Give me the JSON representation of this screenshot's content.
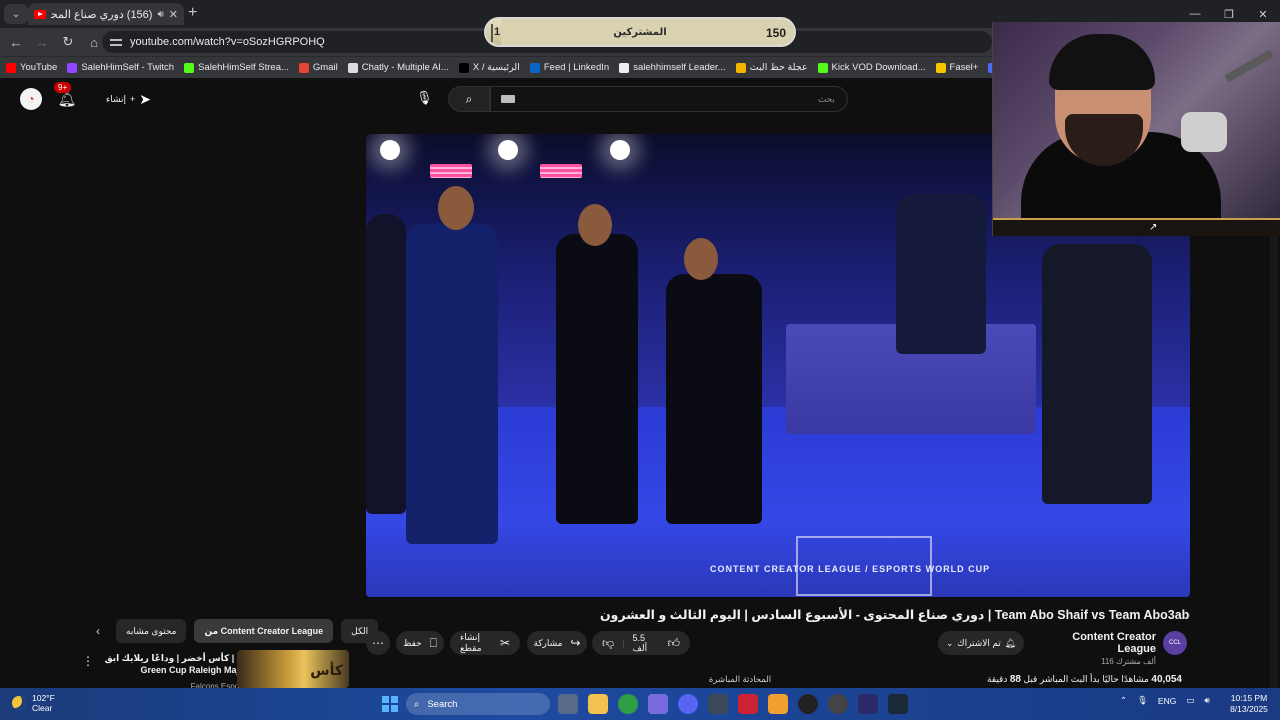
{
  "browser": {
    "tab_title": "(156) دوري صناع المحتوى - ال",
    "url": "youtube.com/watch?v=oSozHGRPOHQ",
    "bookmarks": [
      {
        "label": "YouTube",
        "color": "#ff0000"
      },
      {
        "label": "SalehHimSelf - Twitch",
        "color": "#9146ff"
      },
      {
        "label": "SalehHimSelf Strea...",
        "color": "#53fc18"
      },
      {
        "label": "Gmail",
        "color": "#ea4335"
      },
      {
        "label": "Chatly - Multiple AI...",
        "color": "#dddddd"
      },
      {
        "label": "X / الرئيسية",
        "color": "#000000"
      },
      {
        "label": "Feed | LinkedIn",
        "color": "#0a66c2"
      },
      {
        "label": "salehhimself Leader...",
        "color": "#eeeeee"
      },
      {
        "label": "عجلة حظ البث",
        "color": "#f4b400"
      },
      {
        "label": "Kick VOD Download...",
        "color": "#53fc18"
      },
      {
        "label": "Fasel+",
        "color": "#f7c600"
      },
      {
        "label": "Restream",
        "color": "#4a6cf7"
      },
      {
        "label": "أكاديمية ا...",
        "color": "#888888"
      }
    ]
  },
  "masthead": {
    "notif_count": "9+",
    "create_label": "إنشاء",
    "search_placeholder": "بحث"
  },
  "overlay": {
    "subs_start": "1",
    "subs_label": "المشتركين",
    "subs_goal": "150",
    "progress": 0.05
  },
  "video": {
    "title": "دوري صناع المحتوى - الأسبوع السادس | اليوم الثالث و العشرون | Team Abo Shaif vs Team Abo3abd",
    "channel_name": "Content Creator League",
    "channel_subs": "116 ألف مشترك",
    "subscribed_label": "تم الاشتراك",
    "likes": "5.5 ألف",
    "share_label": "مشاركة",
    "clip_label": "إنشاء مقطع",
    "save_label": "حفظ",
    "views_count": "40,054",
    "views_text": "مشاهدًا حاليًا",
    "stream_text": "بدأ البث المباشر قبل",
    "minutes": "88",
    "minutes_unit": "دقيقة",
    "live_chat_label": "المحادثة المباشرة",
    "logo_text": "CONTENT CREATOR LEAGUE / ESPORTS WORLD CUP"
  },
  "related": {
    "chips": [
      "الكل",
      "من Content Creator League",
      "محتوى مشابه"
    ],
    "item_title_line1": "كأس أخضر | وداعًا ريلايك ابق | 🏆",
    "item_title_line2": "Green Cup Raleigh Major",
    "item_channel": "Falcons Esports",
    "thumb_text": "كأس"
  },
  "taskbar": {
    "temp": "102°F",
    "weather": "Clear",
    "search_label": "Search",
    "lang": "ENG",
    "time": "10:15 PM",
    "date": "8/13/2025"
  }
}
